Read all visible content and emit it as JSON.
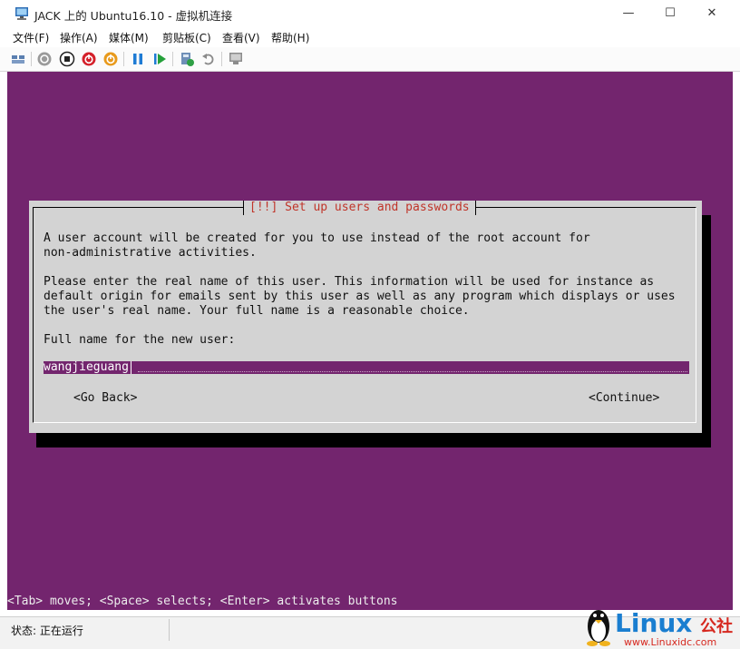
{
  "window": {
    "title": "JACK 上的 Ubuntu16.10 - 虚拟机连接",
    "minimize": "—",
    "maximize": "☐",
    "close": "✕"
  },
  "menu": [
    "文件(F)",
    "操作(A)",
    "媒体(M)",
    "剪贴板(C)",
    "查看(V)",
    "帮助(H)"
  ],
  "toolbar": {
    "icons": [
      "ctrl-alt-del-icon",
      "start-icon",
      "turn-off-icon",
      "shutdown-icon",
      "save-icon",
      "pause-icon",
      "resume-icon",
      "checkpoint-icon",
      "revert-icon",
      "enhanced-session-icon"
    ]
  },
  "installer": {
    "background_color": "#73256e",
    "dialog_title": "[!!] Set up users and passwords",
    "paragraph1_line1": "A user account will be created for you to use instead of the root account for",
    "paragraph1_line2": "non-administrative activities.",
    "paragraph2_line1": "Please enter the real name of this user. This information will be used for instance as",
    "paragraph2_line2": "default origin for emails sent by this user as well as any program which displays or uses",
    "paragraph2_line3": "the user's real name. Your full name is a reasonable choice.",
    "prompt": "Full name for the new user:",
    "input_value": "wangjieguang",
    "go_back": "<Go Back>",
    "continue": "<Continue>",
    "help": "<Tab> moves; <Space> selects; <Enter> activates buttons"
  },
  "status": {
    "text": "状态: 正在运行"
  },
  "watermark": {
    "brand": "Linux",
    "suffix": "公社",
    "site": "www.Linuxidc.com"
  }
}
